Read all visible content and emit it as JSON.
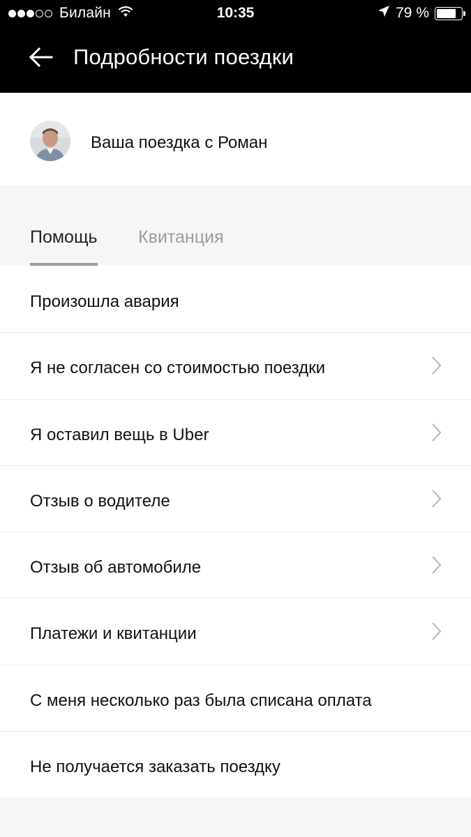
{
  "status_bar": {
    "signal_dots": [
      true,
      true,
      true,
      false,
      false
    ],
    "carrier": "Билайн",
    "time": "10:35",
    "battery": "79 %",
    "battery_level": 0.79
  },
  "header": {
    "back_icon": "arrow-left-icon",
    "title": "Подробности поездки"
  },
  "driver": {
    "text": "Ваша поездка с Роман"
  },
  "tabs": [
    {
      "label": "Помощь",
      "active": true
    },
    {
      "label": "Квитанция",
      "active": false
    }
  ],
  "help_items": [
    {
      "label": "Произошла авария",
      "chevron": false
    },
    {
      "label": "Я не согласен со стоимостью поездки",
      "chevron": true
    },
    {
      "label": "Я оставил вещь в Uber",
      "chevron": true
    },
    {
      "label": "Отзыв о водителе",
      "chevron": true
    },
    {
      "label": "Отзыв об автомобиле",
      "chevron": true
    },
    {
      "label": "Платежи и квитанции",
      "chevron": true
    },
    {
      "label": "С меня несколько раз была списана оплата",
      "chevron": false
    },
    {
      "label": "Не получается заказать поездку",
      "chevron": false
    }
  ],
  "colors": {
    "header_bg": "#000000",
    "page_bg": "#f6f6f6",
    "inactive_tab": "#9b9b9b"
  }
}
